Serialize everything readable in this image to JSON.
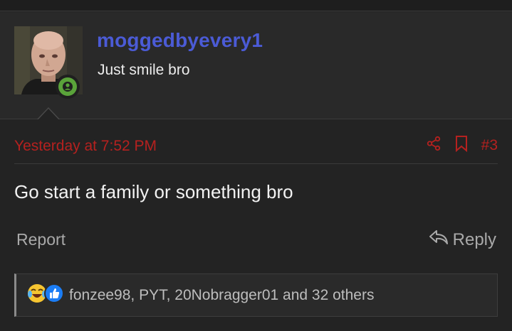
{
  "author": {
    "username": "moggedbyevery1",
    "title": "Just smile bro"
  },
  "post": {
    "date": "Yesterday at 7:52 PM",
    "number": "#3",
    "body": "Go start a family or something bro",
    "report_label": "Report",
    "reply_label": "Reply"
  },
  "reactions": {
    "icons": [
      "tears-of-joy-icon",
      "like-icon"
    ],
    "text": "fonzee98, PYT, 20Nobragger01 and 32 others"
  },
  "colors": {
    "username": "#4b5bd6",
    "accent_red": "#b5211f",
    "online": "#5aa33a",
    "background": "#232323"
  }
}
